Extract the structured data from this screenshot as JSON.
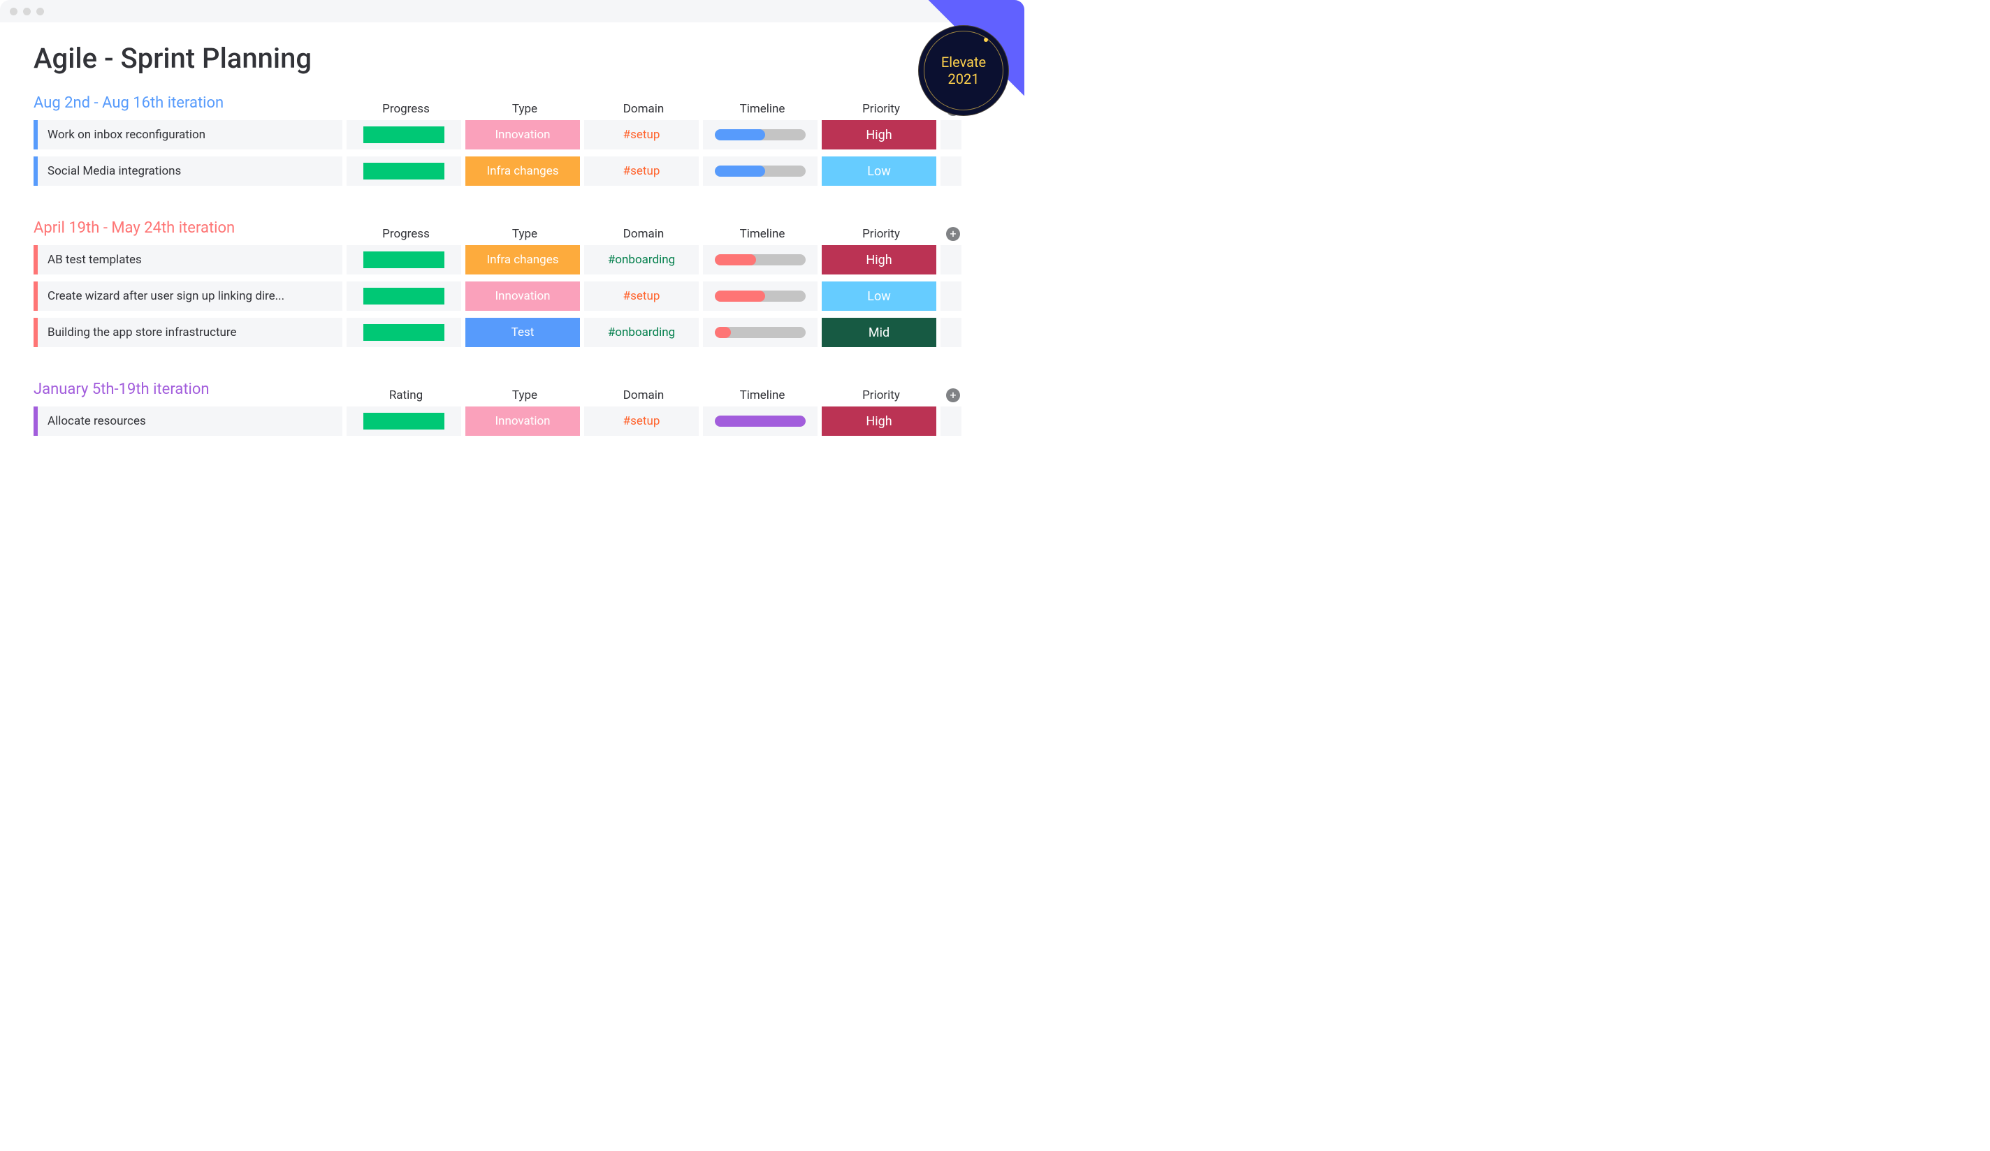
{
  "page": {
    "title": "Agile - Sprint Planning"
  },
  "badge": {
    "line1": "Elevate",
    "line2": "2021"
  },
  "groups": [
    {
      "title": "Aug 2nd - Aug 16th iteration",
      "title_color": "clr-blue",
      "border": "#579bfc",
      "columns": [
        "Progress",
        "Type",
        "Domain",
        "Timeline",
        "Priority"
      ],
      "rows": [
        {
          "name": "Work on inbox reconfiguration",
          "type": {
            "label": "Innovation",
            "bg": "bg-pink"
          },
          "domain": {
            "label": "#setup",
            "txt": "txt-coral"
          },
          "timeline": {
            "pct": 55,
            "color": "tl-blue"
          },
          "priority": {
            "label": "High",
            "bg": "bg-high"
          }
        },
        {
          "name": "Social Media integrations",
          "type": {
            "label": "Infra changes",
            "bg": "bg-orange"
          },
          "domain": {
            "label": "#setup",
            "txt": "txt-coral"
          },
          "timeline": {
            "pct": 55,
            "color": "tl-blue"
          },
          "priority": {
            "label": "Low",
            "bg": "bg-low"
          }
        }
      ]
    },
    {
      "title": "April 19th - May 24th iteration",
      "title_color": "clr-coral",
      "border": "#fe7575",
      "columns": [
        "Progress",
        "Type",
        "Domain",
        "Timeline",
        "Priority"
      ],
      "rows": [
        {
          "name": "AB test templates",
          "type": {
            "label": "Infra changes",
            "bg": "bg-orange"
          },
          "domain": {
            "label": "#onboarding",
            "txt": "txt-green"
          },
          "timeline": {
            "pct": 45,
            "color": "tl-coral"
          },
          "priority": {
            "label": "High",
            "bg": "bg-high"
          }
        },
        {
          "name": "Create wizard after user sign up linking dire...",
          "type": {
            "label": "Innovation",
            "bg": "bg-pink"
          },
          "domain": {
            "label": "#setup",
            "txt": "txt-coral"
          },
          "timeline": {
            "pct": 55,
            "color": "tl-coral"
          },
          "priority": {
            "label": "Low",
            "bg": "bg-low"
          }
        },
        {
          "name": "Building the app store infrastructure",
          "type": {
            "label": "Test",
            "bg": "bg-blue"
          },
          "domain": {
            "label": "#onboarding",
            "txt": "txt-green"
          },
          "timeline": {
            "pct": 18,
            "color": "tl-coral"
          },
          "priority": {
            "label": "Mid",
            "bg": "bg-mid"
          }
        }
      ]
    },
    {
      "title": "January 5th-19th iteration",
      "title_color": "clr-violet",
      "border": "#a25ddc",
      "columns": [
        "Rating",
        "Type",
        "Domain",
        "Timeline",
        "Priority"
      ],
      "rows": [
        {
          "name": "Allocate resources",
          "type": {
            "label": "Innovation",
            "bg": "bg-pink"
          },
          "domain": {
            "label": "#setup",
            "txt": "txt-coral"
          },
          "timeline": {
            "pct": 100,
            "color": "tl-violet"
          },
          "priority": {
            "label": "High",
            "bg": "bg-high"
          }
        }
      ]
    }
  ]
}
